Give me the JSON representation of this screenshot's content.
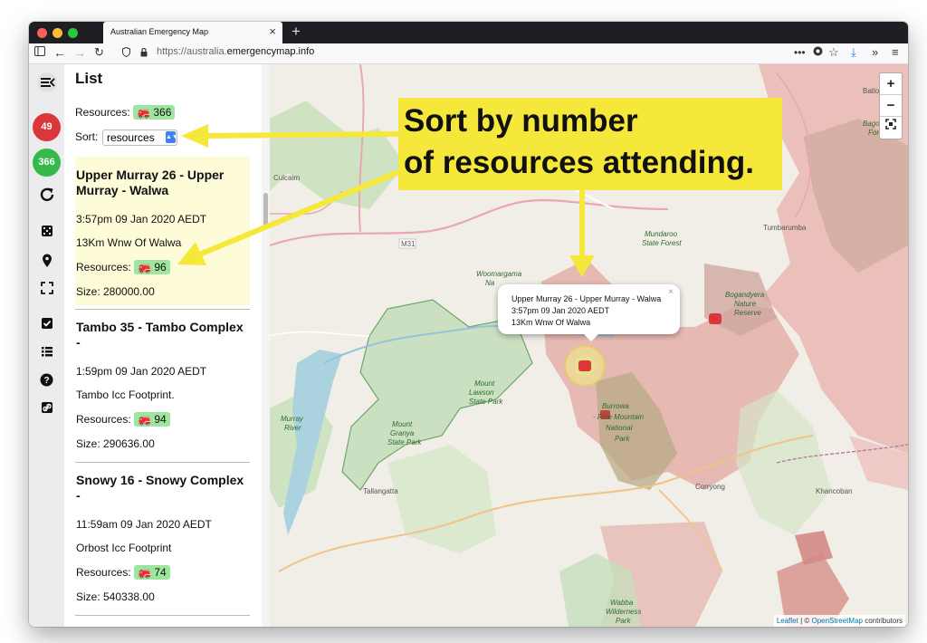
{
  "browser": {
    "tab_title": "Australian Emergency Map",
    "url_prefix": "https://australia.",
    "url_domain": "emergencymap.info"
  },
  "rail": {
    "incident_count": "49",
    "resource_count": "366"
  },
  "panel": {
    "title": "List",
    "resources_label": "Resources:",
    "resources_total": "366",
    "sort_label": "Sort:",
    "sort_value": "resources"
  },
  "incidents": [
    {
      "title": "Upper Murray 26 - Upper Murray - Walwa",
      "time": "3:57pm 09 Jan 2020 AEDT",
      "location": "13Km Wnw Of Walwa",
      "resources_label": "Resources:",
      "resources": "96",
      "size": "Size: 280000.00"
    },
    {
      "title": "Tambo 35 - Tambo Complex -",
      "time": "1:59pm 09 Jan 2020 AEDT",
      "location": "Tambo Icc Footprint.",
      "resources_label": "Resources:",
      "resources": "94",
      "size": "Size: 290636.00"
    },
    {
      "title": "Snowy 16 - Snowy Complex -",
      "time": "11:59am 09 Jan 2020 AEDT",
      "location": "Orbost Icc Footprint",
      "resources_label": "Resources:",
      "resources": "74",
      "size": "Size: 540338.00"
    }
  ],
  "map": {
    "popup": {
      "title": "Upper Murray 26 - Upper Murray - Walwa",
      "time": "3:57pm 09 Jan 2020 AEDT",
      "location": "13Km Wnw Of Walwa",
      "close": "×"
    },
    "zoom_in": "+",
    "zoom_out": "−",
    "attribution_leaflet": "Leaflet",
    "attribution_sep": " | © ",
    "attribution_osm": "OpenStreetMap",
    "attribution_suffix": " contributors",
    "places": [
      "Batlow",
      "Culcairn",
      "Tumbarumba",
      "Mundaroo State Forest",
      "Bago State Forest",
      "Woomargama Na",
      "Bogandyera Nature Reserve",
      "Mount Lawson State Park",
      "Mount Granya State Park",
      "Murray River",
      "Burrowa - Pine Mountain National Park",
      "Tallangatta",
      "Corryong",
      "Khancoban",
      "Wabba Wilderness Park",
      "M31"
    ]
  },
  "annotation": {
    "line1": "Sort by number",
    "line2": "of resources attending."
  },
  "colors": {
    "badge_red": "#d9373a",
    "badge_green": "#36b84a",
    "callout_yellow": "#f6e83a",
    "resource_pill": "#9ee69e"
  }
}
